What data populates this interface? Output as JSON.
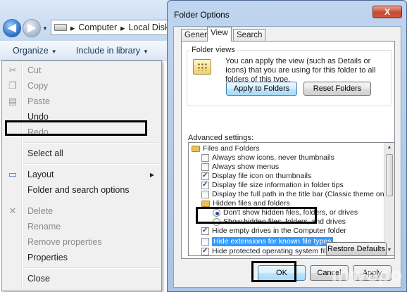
{
  "explorer": {
    "address_parts": [
      "Computer",
      "Local Disk"
    ],
    "toolbar": {
      "organize": "Organize",
      "include_in_library": "Include in library"
    }
  },
  "organize_menu": {
    "items": [
      {
        "label": "Cut",
        "enabled": false,
        "icon": "scissors-icon"
      },
      {
        "label": "Copy",
        "enabled": false,
        "icon": "copy-icon"
      },
      {
        "label": "Paste",
        "enabled": false,
        "icon": "paste-icon"
      },
      {
        "label": "Undo",
        "enabled": true
      },
      {
        "label": "Redo",
        "enabled": false
      },
      {
        "label": "Select all",
        "enabled": true
      },
      {
        "label": "Layout",
        "enabled": true,
        "icon": "layout-icon",
        "submenu": true
      },
      {
        "label": "Folder and search options",
        "enabled": true,
        "highlighted": true
      },
      {
        "label": "Delete",
        "enabled": false,
        "icon": "delete-icon"
      },
      {
        "label": "Rename",
        "enabled": false
      },
      {
        "label": "Remove properties",
        "enabled": false
      },
      {
        "label": "Properties",
        "enabled": true
      },
      {
        "label": "Close",
        "enabled": true
      }
    ]
  },
  "dialog": {
    "title": "Folder Options",
    "close_glyph": "X",
    "tabs": [
      "General",
      "View",
      "Search"
    ],
    "active_tab": "View",
    "folder_views": {
      "label": "Folder views",
      "description": "You can apply the view (such as Details or Icons) that you are using for this folder to all folders of this type.",
      "apply_button": "Apply to Folders",
      "reset_button": "Reset Folders"
    },
    "advanced_label": "Advanced settings:",
    "tree": [
      {
        "type": "folder",
        "label": "Files and Folders"
      },
      {
        "type": "checkbox",
        "checked": false,
        "label": "Always show icons, never thumbnails"
      },
      {
        "type": "checkbox",
        "checked": false,
        "label": "Always show menus"
      },
      {
        "type": "checkbox",
        "checked": true,
        "label": "Display file icon on thumbnails"
      },
      {
        "type": "checkbox",
        "checked": true,
        "label": "Display file size information in folder tips"
      },
      {
        "type": "checkbox",
        "checked": false,
        "label": "Display the full path in the title bar (Classic theme only)"
      },
      {
        "type": "folder",
        "label": "Hidden files and folders"
      },
      {
        "type": "radio",
        "checked": true,
        "label": "Don't show hidden files, folders, or drives"
      },
      {
        "type": "radio",
        "checked": false,
        "label": "Show hidden files, folders, and drives"
      },
      {
        "type": "checkbox",
        "checked": true,
        "label": "Hide empty drives in the Computer folder"
      },
      {
        "type": "checkbox",
        "checked": false,
        "label": "Hide extensions for known file types",
        "selected": true
      },
      {
        "type": "checkbox",
        "checked": true,
        "label": "Hide protected operating system files (Recommended)"
      }
    ],
    "restore_defaults": "Restore Defaults",
    "ok": "OK",
    "cancel": "Cancel",
    "apply": "Apply"
  },
  "watermark": "Inwepo"
}
